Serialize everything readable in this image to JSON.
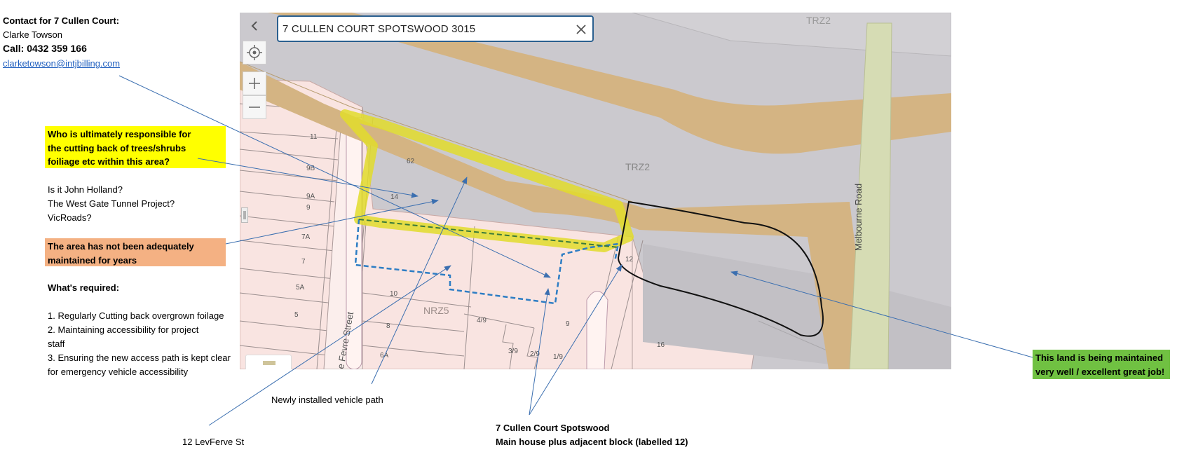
{
  "contact": {
    "heading": "Contact for 7 Cullen Court:",
    "name": "Clarke Towson",
    "phone": "Call: 0432 359 166",
    "email": "clarketowson@intjbilling.com"
  },
  "question": {
    "highlight_lines": [
      "Who is ultimately responsible for",
      "the cutting back of trees/shrubs",
      "foiliage etc within this area?"
    ],
    "options": [
      "Is it John Holland?",
      "The West Gate Tunnel Project?",
      "VicRoads?"
    ]
  },
  "maintenance_note": [
    "The area has not been adequately",
    "maintained for years"
  ],
  "required": {
    "heading": "What's required:",
    "items": [
      "1. Regularly Cutting back overgrown foilage",
      "2. Maintaining accessibility for project",
      "staff",
      "3. Ensuring the new access path is kept clear",
      "for emergency vehicle accessibility"
    ]
  },
  "praise": [
    "This land is being maintained",
    "very well / excellent great job!"
  ],
  "callouts": {
    "vehicle_path": "Newly installed vehicle path",
    "levferve": "12 LevFerve St",
    "cullen_line1": "7 Cullen Court Spotswood",
    "cullen_line2": "Main house plus adjacent block (labelled 12)"
  },
  "map": {
    "search_value": "7 CULLEN COURT SPOTSWOOD 3015",
    "zone_labels": [
      "TRZ2",
      "TRZ2",
      "NRZ5"
    ],
    "street_labels": [
      "Melbourne Road",
      "e Fevre Street"
    ],
    "lot_numbers": [
      "11",
      "9B",
      "9A",
      "9",
      "7A",
      "7",
      "5A",
      "5",
      "62",
      "14",
      "10",
      "8",
      "6A",
      "4/9",
      "9",
      "3/9",
      "2/9",
      "1/9",
      "12",
      "16"
    ],
    "controls": [
      "back-icon",
      "locate-icon",
      "zoom-in-icon",
      "zoom-out-icon",
      "clear-icon",
      "collapse-handle-icon"
    ]
  },
  "colors": {
    "highlight_yellow": "#ffff00",
    "highlight_orange": "#f4b183",
    "highlight_green": "#70c142",
    "road_tan": "#d4b483",
    "residential_pink": "#f9e4e1",
    "arrow_blue": "#3b6fb0"
  }
}
